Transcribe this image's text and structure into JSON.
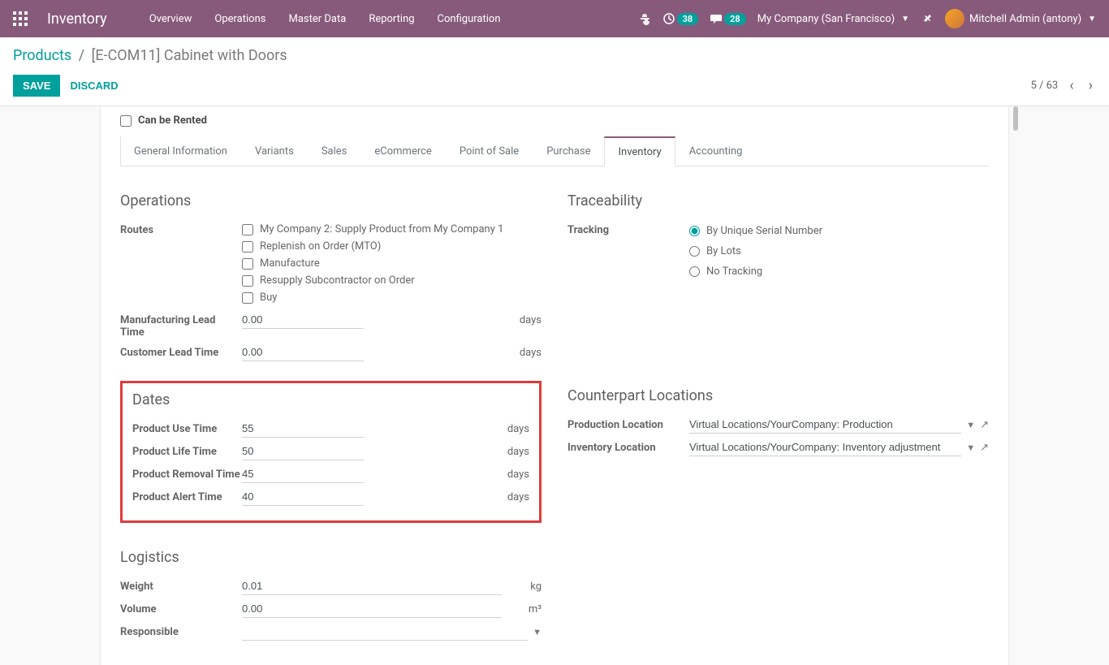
{
  "nav": {
    "brand": "Inventory",
    "menu": [
      "Overview",
      "Operations",
      "Master Data",
      "Reporting",
      "Configuration"
    ],
    "badge1": "38",
    "badge2": "28",
    "company": "My Company (San Francisco)",
    "user": "Mitchell Admin (antony)"
  },
  "breadcrumb": {
    "root": "Products",
    "current": "[E-COM11] Cabinet with Doors"
  },
  "buttons": {
    "save": "Save",
    "discard": "Discard"
  },
  "pager": {
    "pos": "5 / 63"
  },
  "checkbox_top": "Can be Rented",
  "tabs": [
    "General Information",
    "Variants",
    "Sales",
    "eCommerce",
    "Point of Sale",
    "Purchase",
    "Inventory",
    "Accounting"
  ],
  "active_tab": 6,
  "operations": {
    "title": "Operations",
    "routes_label": "Routes",
    "routes": [
      "My Company 2: Supply Product from My Company 1",
      "Replenish on Order (MTO)",
      "Manufacture",
      "Resupply Subcontractor on Order",
      "Buy"
    ],
    "mfg_lead_label": "Manufacturing Lead Time",
    "mfg_lead": "0.00",
    "cust_lead_label": "Customer Lead Time",
    "cust_lead": "0.00",
    "days": "days"
  },
  "traceability": {
    "title": "Traceability",
    "tracking_label": "Tracking",
    "options": [
      "By Unique Serial Number",
      "By Lots",
      "No Tracking"
    ],
    "selected": 0
  },
  "dates": {
    "title": "Dates",
    "use_label": "Product Use Time",
    "use": "55",
    "life_label": "Product Life Time",
    "life": "50",
    "rem_label": "Product Removal Time",
    "rem": "45",
    "alert_label": "Product Alert Time",
    "alert": "40",
    "days": "days"
  },
  "counterpart": {
    "title": "Counterpart Locations",
    "prod_label": "Production Location",
    "prod_val": "Virtual Locations/YourCompany: Production",
    "inv_label": "Inventory Location",
    "inv_val": "Virtual Locations/YourCompany: Inventory adjustment"
  },
  "logistics": {
    "title": "Logistics",
    "weight_label": "Weight",
    "weight": "0.01",
    "weight_unit": "kg",
    "volume_label": "Volume",
    "volume": "0.00",
    "volume_unit": "m³",
    "resp_label": "Responsible",
    "resp": ""
  }
}
